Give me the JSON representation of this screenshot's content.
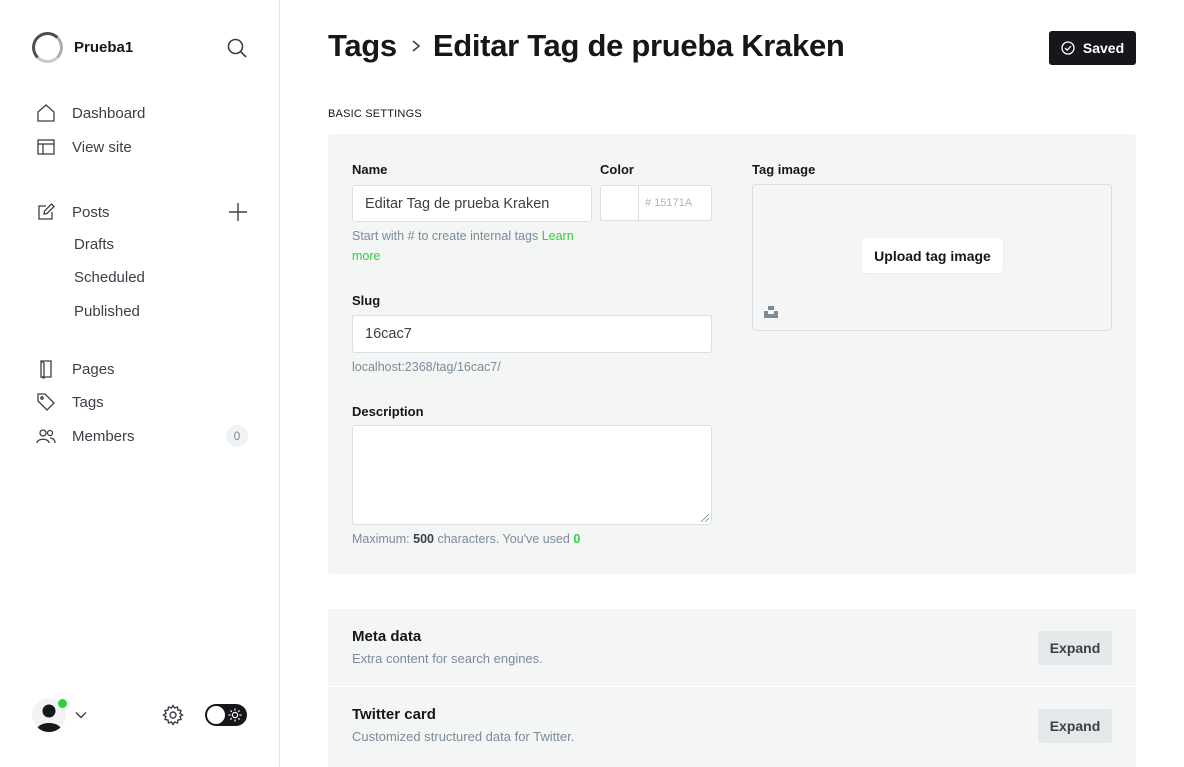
{
  "sidebar": {
    "brand_name": "Prueba1",
    "nav": {
      "dashboard": "Dashboard",
      "view_site": "View site",
      "posts": "Posts",
      "drafts": "Drafts",
      "scheduled": "Scheduled",
      "published": "Published",
      "pages": "Pages",
      "tags": "Tags",
      "members": "Members",
      "members_count": "0"
    },
    "icons": [
      "search-icon",
      "home-icon",
      "view-site-icon",
      "edit-icon",
      "plus-icon",
      "pages-icon",
      "tag-icon",
      "members-icon",
      "gear-icon",
      "sun-icon",
      "chevron-down-icon"
    ]
  },
  "header": {
    "breadcrumb_parent": "Tags",
    "breadcrumb_current": "Editar Tag de prueba Kraken",
    "saved_label": "Saved"
  },
  "basic": {
    "section_label": "Basic settings",
    "name_label": "Name",
    "name_value": "Editar Tag de prueba Kraken",
    "name_hint": "Start with # to create internal tags",
    "name_hint_link": "Learn more",
    "color_label": "Color",
    "color_hash": "#",
    "color_placeholder": "15171A",
    "slug_label": "Slug",
    "slug_value": "16cac7",
    "slug_url": "localhost:2368/tag/16cac7/",
    "description_label": "Description",
    "description_value": "",
    "desc_hint_prefix": "Maximum:",
    "desc_hint_max": "500",
    "desc_hint_mid": "characters. You've used",
    "desc_hint_used": "0",
    "tag_image_label": "Tag image",
    "upload_label": "Upload tag image"
  },
  "expanders": [
    {
      "title": "Meta data",
      "desc": "Extra content for search engines.",
      "button": "Expand"
    },
    {
      "title": "Twitter card",
      "desc": "Customized structured data for Twitter.",
      "button": "Expand"
    }
  ],
  "colors": {
    "accent": "#30cf43",
    "dark": "#15171a",
    "panel": "#f4f5f5",
    "muted": "#7c8b9a"
  }
}
